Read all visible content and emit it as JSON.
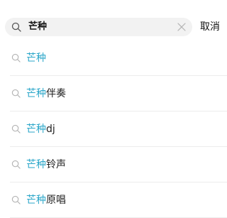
{
  "search": {
    "query": "芒种"
  },
  "cancel_label": "取消",
  "suggestions": [
    {
      "highlight": "芒种",
      "rest": ""
    },
    {
      "highlight": "芒种",
      "rest": "伴奏"
    },
    {
      "highlight": "芒种",
      "rest": "dj"
    },
    {
      "highlight": "芒种",
      "rest": "铃声"
    },
    {
      "highlight": "芒种",
      "rest": "原唱"
    }
  ],
  "colors": {
    "highlight": "#2aa6c9",
    "search_bg": "#f2f2f2",
    "icon": "#b3b3b3"
  },
  "icons": {
    "search": "search-icon",
    "clear": "close-icon"
  }
}
